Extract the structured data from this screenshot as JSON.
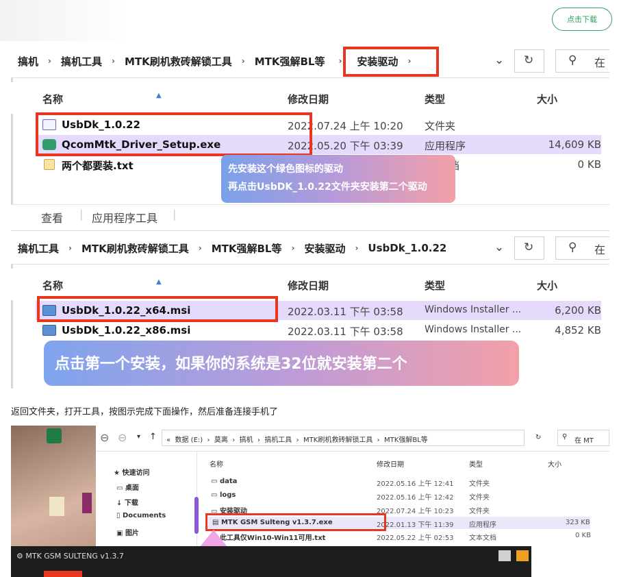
{
  "header": {
    "download_label": "点击下载"
  },
  "shot1": {
    "address": {
      "crumbs": [
        "搞机",
        "搞机工具",
        "MTK刷机救砖解锁工具",
        "MTK强解BL等",
        "安装驱动"
      ],
      "search_hint": "在"
    },
    "columns": {
      "name": "名称",
      "date": "修改日期",
      "type": "类型",
      "size": "大小"
    },
    "rows": [
      {
        "name": "UsbDk_1.0.22",
        "date": "2022.07.24 上午 10:20",
        "type": "文件夹",
        "size": ""
      },
      {
        "name": "QcomMtk_Driver_Setup.exe",
        "date": "2022.05.20 下午 03:39",
        "type": "应用程序",
        "size": "14,609 KB"
      },
      {
        "name": "两个都要装.txt",
        "date": "",
        "type": "档",
        "size": "0 KB"
      }
    ],
    "note_lines": [
      "先安装这个绿色图标的驱动",
      "再点击UsbDK_1.0.22文件夹安装第二个驱动"
    ],
    "toolbar": {
      "view": "查看",
      "app_tools": "应用程序工具"
    }
  },
  "shot1b": {
    "address": {
      "crumbs": [
        "搞机工具",
        "MTK刷机救砖解锁工具",
        "MTK强解BL等",
        "安装驱动",
        "UsbDk_1.0.22"
      ],
      "search_hint": "在"
    },
    "columns": {
      "name": "名称",
      "date": "修改日期",
      "type": "类型",
      "size": "大小"
    },
    "rows": [
      {
        "name": "UsbDk_1.0.22_x64.msi",
        "date": "2022.03.11 下午 03:58",
        "type": "Windows Installer ...",
        "size": "6,200 KB"
      },
      {
        "name": "UsbDk_1.0.22_x86.msi",
        "date": "2022.03.11 下午 03:58",
        "type": "Windows Installer ...",
        "size": "4,852 KB"
      }
    ],
    "note": "点击第一个安装，如果你的系统是32位就安装第二个"
  },
  "caption": "返回文件夹，打开工具，按图示完成下面操作，然后准备连接手机了",
  "shot2": {
    "address": {
      "crumbs": [
        "数据 (E:)",
        "莫离",
        "搞机",
        "搞机工具",
        "MTK刷机救砖解锁工具",
        "MTK强解BL等"
      ],
      "search_hint": "在 MT"
    },
    "nav": [
      "快速访问",
      "桌面",
      "下载",
      "Documents",
      "图片"
    ],
    "columns": {
      "name": "名称",
      "date": "修改日期",
      "type": "类型",
      "size": "大小"
    },
    "rows": [
      {
        "name": "data",
        "date": "2022.05.16 上午 12:41",
        "type": "文件夹",
        "size": ""
      },
      {
        "name": "logs",
        "date": "2022.05.16 上午 12:42",
        "type": "文件夹",
        "size": ""
      },
      {
        "name": "安装驱动",
        "date": "2022.07.24 上午 10:23",
        "type": "文件夹",
        "size": ""
      },
      {
        "name": "MTK GSM Sulteng v1.3.7.exe",
        "date": "2022.01.13 下午 11:39",
        "type": "应用程序",
        "size": "323 KB"
      },
      {
        "name": "此工具仅Win10-Win11可用.txt",
        "date": "2022.05.22 上午 02:53",
        "type": "文本文档",
        "size": "0 KB"
      }
    ],
    "gsm_title": "MTK GSM SULTENG v1.3.7"
  },
  "colors": {
    "highlight": "#e8361f",
    "accent": "#2e9e62",
    "selected_row": "#e5dafc"
  }
}
